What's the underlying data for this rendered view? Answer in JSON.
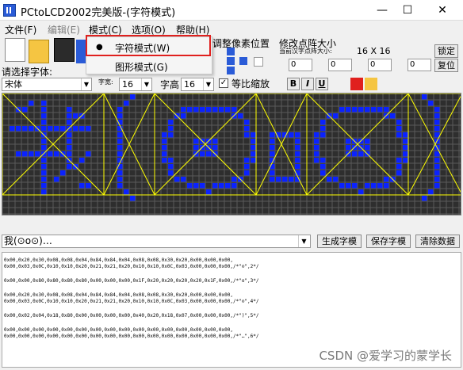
{
  "window": {
    "title": "PCtoLCD2002完美版-(字符模式)"
  },
  "menu": {
    "items": [
      {
        "label": "文件(F)",
        "disabled": false
      },
      {
        "label": "编辑(E)",
        "disabled": true
      },
      {
        "label": "模式(C)",
        "disabled": false
      },
      {
        "label": "选项(O)",
        "disabled": false
      },
      {
        "label": "帮助(H)",
        "disabled": false
      }
    ],
    "mode_menu": [
      {
        "label": "字符模式(W)",
        "checked": true
      },
      {
        "label": "图形模式(G)",
        "checked": false
      }
    ]
  },
  "toolbar": {
    "adjust_group_title": "调整像素位置",
    "resize_group_title": "修改点阵大小",
    "current_size_label": "当前汉字点阵大小:",
    "size_display": "16 X 16",
    "lock_button": "锁定",
    "restore_button": "复位",
    "spin_values": [
      "0",
      "0",
      "0",
      "0"
    ]
  },
  "font": {
    "select_label": "请选择字体:",
    "font_name": "宋体",
    "width_label": "字宽:",
    "width_value": "16",
    "height_label": "字高",
    "height_value": "16",
    "proportional_label": "等比缩放",
    "proportional_checked": true,
    "bold_label": "B",
    "italic_label": "I",
    "underline_label": "U"
  },
  "input": {
    "text": "我(⊙o⊙)…",
    "generate_button": "生成字模",
    "save_button": "保存字模",
    "clear_button": "清除数据"
  },
  "output_lines": [
    [
      "0x00,0x20,0x30,0x08,0x08,0x04,0x84,0x84,0x04,0x08,0x08,0x30,0x20,0x00,0x00,0x00,",
      "0x00,0x03,0x0C,0x10,0x10,0x20,0x21,0x21,0x20,0x10,0x10,0x0C,0x03,0x00,0x00,0x00,/*\"⊙\",2*/"
    ],
    [
      "0x00,0x00,0x80,0x80,0x80,0x80,0x00,0x00,0x00,0x1F,0x20,0x20,0x20,0x20,0x1F,0x00,/*\"o\",3*/"
    ],
    [
      "0x00,0x20,0x30,0x08,0x08,0x04,0x84,0x84,0x04,0x08,0x08,0x30,0x20,0x00,0x00,0x00,",
      "0x00,0x03,0x0C,0x10,0x10,0x20,0x21,0x21,0x20,0x10,0x10,0x0C,0x03,0x00,0x00,0x00,/*\"⊙\",4*/"
    ],
    [
      "0x00,0x02,0x04,0x18,0x80,0x00,0x00,0x00,0x00,0x40,0x20,0x18,0x07,0x00,0x00,0x00,/*\")\",5*/"
    ],
    [
      "0x00,0x00,0x00,0x00,0x00,0x00,0x00,0x00,0x00,0x00,0x00,0x00,0x00,0x00,0x00,0x00,",
      "0x00,0x00,0x00,0x00,0x00,0x00,0x00,0x00,0x00,0x00,0x00,0x00,0x00,0x00,0x00,0x00,/*\"…\",6*/"
    ]
  ],
  "watermark": "CSDN @爱学习的蒙学长",
  "colors": {
    "pixel_on": "#0a22ff",
    "pixel_off": "#2e2e2e",
    "grid": "#5a5a5a",
    "frame": "#ffff00",
    "highlight": "#e0201e"
  }
}
